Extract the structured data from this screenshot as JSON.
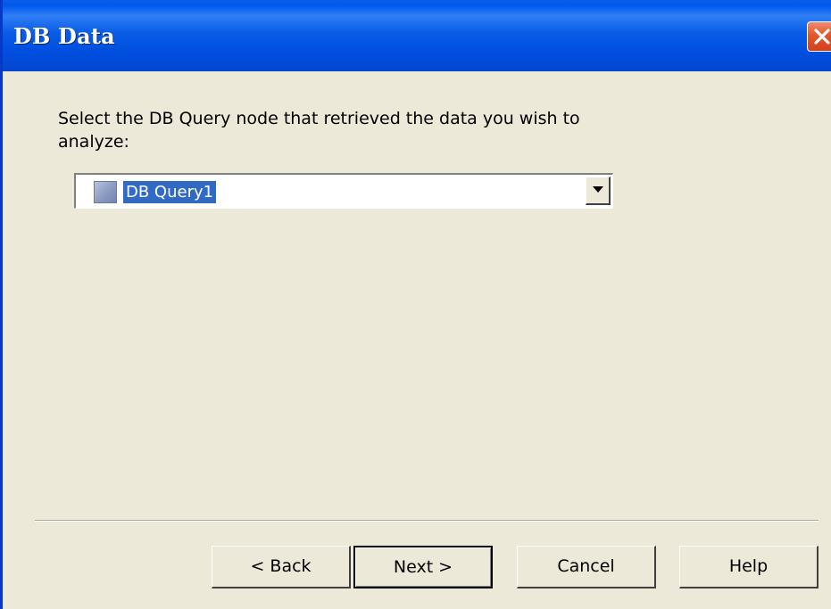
{
  "window": {
    "title": "DB Data"
  },
  "prompt": {
    "text": "Select the DB Query node that retrieved the data you wish to analyze:"
  },
  "query_select": {
    "selected_value": "DB Query1",
    "icon": "db-query-node-icon"
  },
  "buttons": {
    "back": "< Back",
    "next": "Next >",
    "cancel": "Cancel",
    "help": "Help"
  },
  "colors": {
    "titlebar": "#0a5de6",
    "dialog_background": "#ece9d8",
    "close_button": "#e2562f",
    "selection_highlight": "#316ac5"
  }
}
